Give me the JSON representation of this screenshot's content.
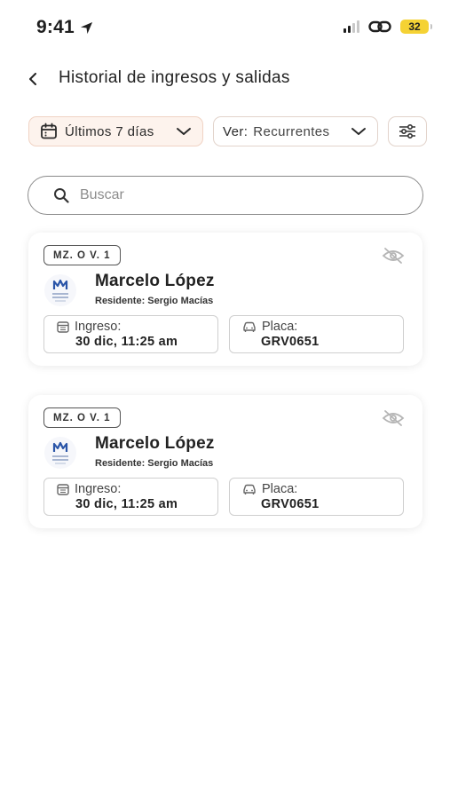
{
  "status_bar": {
    "time": "9:41",
    "battery": "32"
  },
  "header": {
    "title": "Historial de ingresos y salidas"
  },
  "filters": {
    "date_range": "Últimos 7 días",
    "view_prefix": "Ver:",
    "view_value": "Recurrentes"
  },
  "search": {
    "placeholder": "Buscar"
  },
  "records": [
    {
      "lot": "MZ. O V. 1",
      "name": "Marcelo López",
      "resident": "Residente: Sergio Macías",
      "entry_label": "Ingreso:",
      "entry_value": "30 dic, 11:25 am",
      "plate_label": "Placa:",
      "plate_value": "GRV0651"
    },
    {
      "lot": "MZ. O V. 1",
      "name": "Marcelo López",
      "resident": "Residente: Sergio Macías",
      "entry_label": "Ingreso:",
      "entry_value": "30 dic, 11:25 am",
      "plate_label": "Placa:",
      "plate_value": "GRV0651"
    }
  ],
  "colors": {
    "accent_chip_bg": "#fdf3ed",
    "accent_chip_border": "#f0d3c4",
    "battery": "#f5d234",
    "logo_blue": "#2a55a8"
  }
}
